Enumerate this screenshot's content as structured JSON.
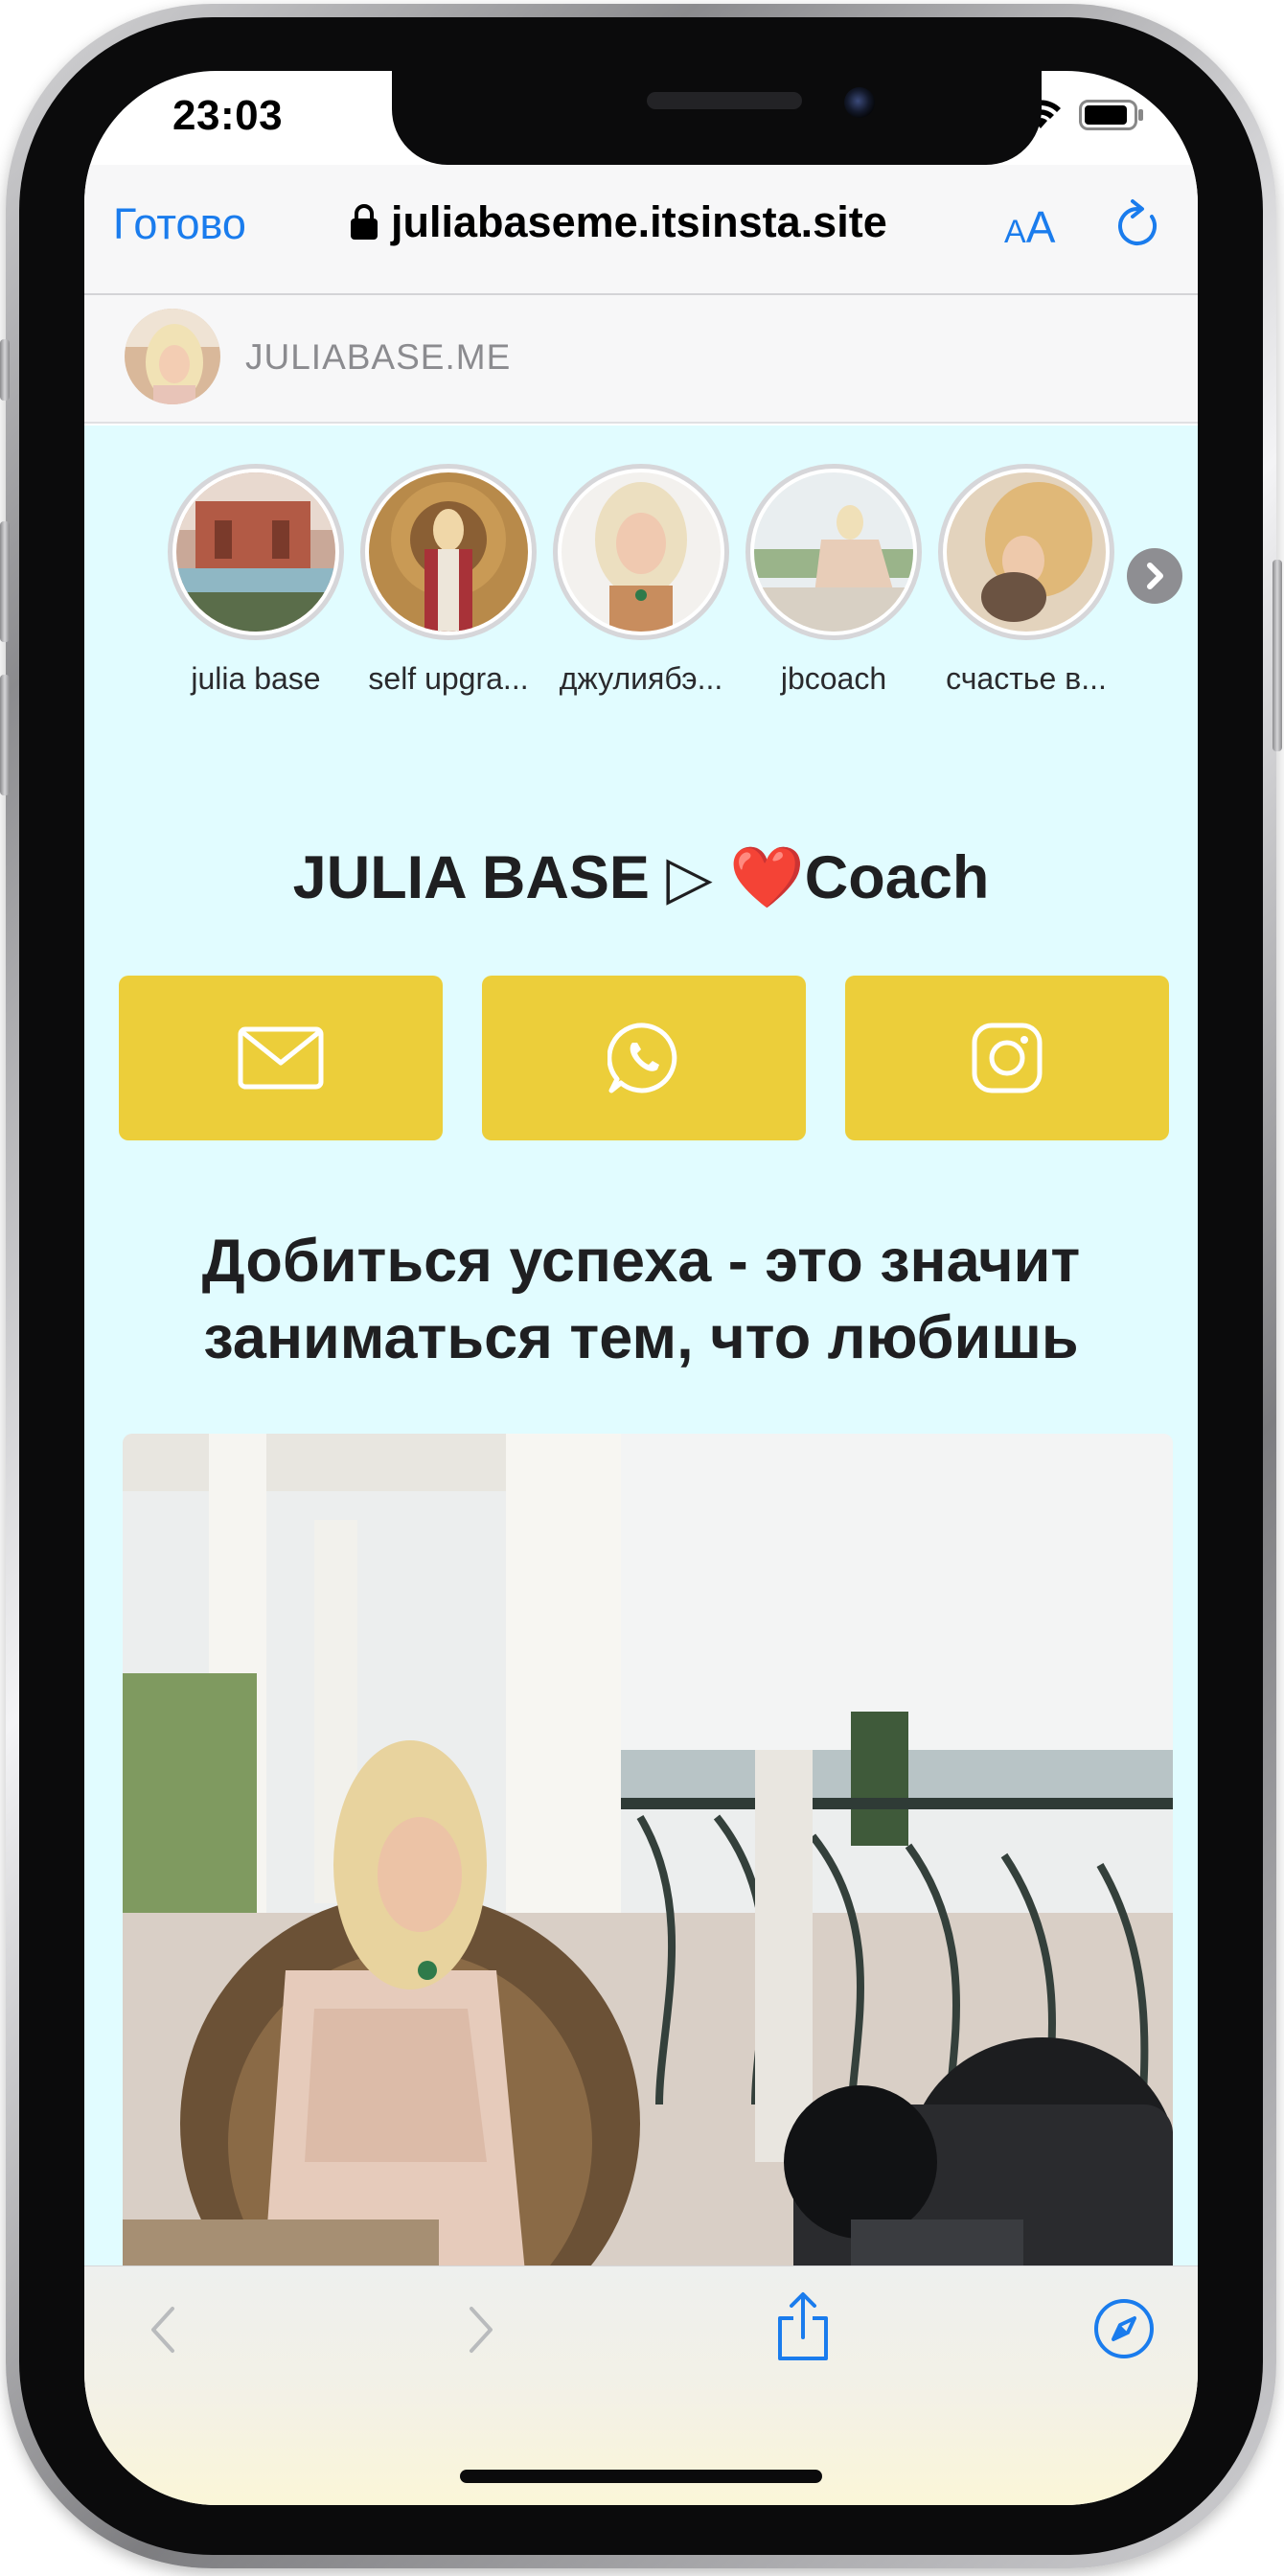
{
  "status_bar": {
    "time": "23:03"
  },
  "browser": {
    "done_label": "Готово",
    "url": "juliabaseme.itsinsta.site",
    "text_size_label_small": "A",
    "text_size_label_large": "A",
    "reload_icon": "reload-icon",
    "lock_icon": "lock-icon",
    "accent_color": "#1a7ced"
  },
  "site": {
    "name": "JULIABASE.ME"
  },
  "stories": [
    {
      "label": "julia base"
    },
    {
      "label": "self upgra..."
    },
    {
      "label": "джулиябэ..."
    },
    {
      "label": "jbcoach"
    },
    {
      "label": "счастье в..."
    }
  ],
  "profile": {
    "title_prefix": "JULIA BASE ▷ ",
    "heart": "❤️",
    "title_suffix": "Coach"
  },
  "actions": [
    {
      "icon": "mail-icon"
    },
    {
      "icon": "whatsapp-icon"
    },
    {
      "icon": "instagram-icon"
    }
  ],
  "quote": "Добиться успеха - это значит заниматься тем, что любишь",
  "colors": {
    "page_background": "#e1fcff",
    "action_button": "#ecce3a",
    "text": "#1f1f21"
  }
}
